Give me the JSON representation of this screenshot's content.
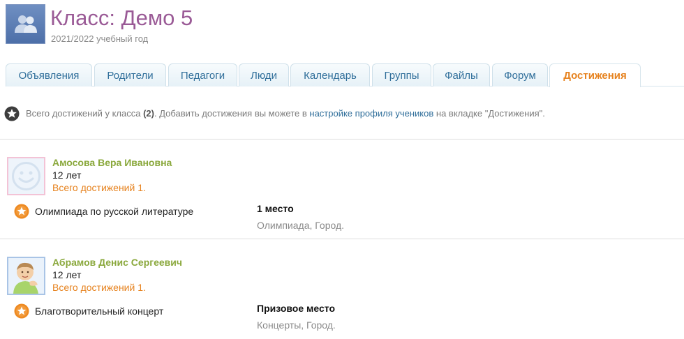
{
  "header": {
    "title": "Класс: Демо 5",
    "subtitle": "2021/2022 учебный год"
  },
  "tabs": [
    {
      "label": "Объявления",
      "active": false
    },
    {
      "label": "Родители",
      "active": false
    },
    {
      "label": "Педагоги",
      "active": false
    },
    {
      "label": "Люди",
      "active": false
    },
    {
      "label": "Календарь",
      "active": false
    },
    {
      "label": "Группы",
      "active": false
    },
    {
      "label": "Файлы",
      "active": false
    },
    {
      "label": "Форум",
      "active": false
    },
    {
      "label": "Достижения",
      "active": true
    }
  ],
  "summary": {
    "prefix": "Всего достижений у класса",
    "count": "(2)",
    "middle": ". Добавить достижения вы можете в",
    "link": "настройке профиля учеников",
    "suffix": "на вкладке \"Достижения\"."
  },
  "students": [
    {
      "name": "Амосова Вера Ивановна",
      "age": "12 лет",
      "count": "Всего достижений 1.",
      "achievement": {
        "title": "Олимпиада по русской литературе",
        "place": "1 место",
        "meta": "Олимпиада, Город."
      }
    },
    {
      "name": "Абрамов Денис Сергеевич",
      "age": "12 лет",
      "count": "Всего достижений 1.",
      "achievement": {
        "title": "Благотворительный концерт",
        "place": "Призовое место",
        "meta": "Концерты, Город."
      }
    }
  ],
  "colors": {
    "title": "#9a5a96",
    "tab_text": "#2f6e9a",
    "tab_active": "#e6821e",
    "student_name": "#8aa83c",
    "count": "#e6821e"
  }
}
